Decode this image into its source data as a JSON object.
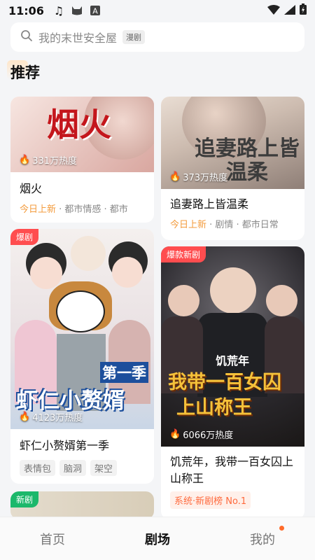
{
  "status": {
    "time": "11:06"
  },
  "search": {
    "placeholder": "我的末世安全屋",
    "tag": "漫剧"
  },
  "section": {
    "title": "推荐"
  },
  "cards": [
    {
      "poster_text": "烟火",
      "heat": "331万热度",
      "title": "烟火",
      "meta_hl": "今日上新",
      "meta": " · 都市情感 · 都市"
    },
    {
      "poster_text": "追妻路上皆温柔",
      "heat": "373万热度",
      "title": "追妻路上皆温柔",
      "meta_hl": "今日上新",
      "meta": " · 剧情 · 都市日常"
    },
    {
      "badge": "爆剧",
      "poster_text": "第一季",
      "poster_text2": "虾仁小赘婿",
      "heat": "4123万热度",
      "title": "虾仁小赘婿第一季",
      "chips": [
        "表情包",
        "脑洞",
        "架空"
      ]
    },
    {
      "badge": "爆款新剧",
      "poster_text": "饥荒年",
      "poster_text2": "我带一百女囚",
      "poster_text3": "上山称王",
      "heat": "6066万热度",
      "title": "饥荒年，我带一百女囚上山称王",
      "rank": "系统·新剧榜 No.1"
    },
    {
      "badge": "新剧"
    }
  ],
  "tabs": {
    "home": "首页",
    "theater": "剧场",
    "mine": "我的"
  },
  "colors": {
    "accent": "#f39b3c",
    "hot": "#ff4d4f",
    "new": "#1cb86b"
  }
}
